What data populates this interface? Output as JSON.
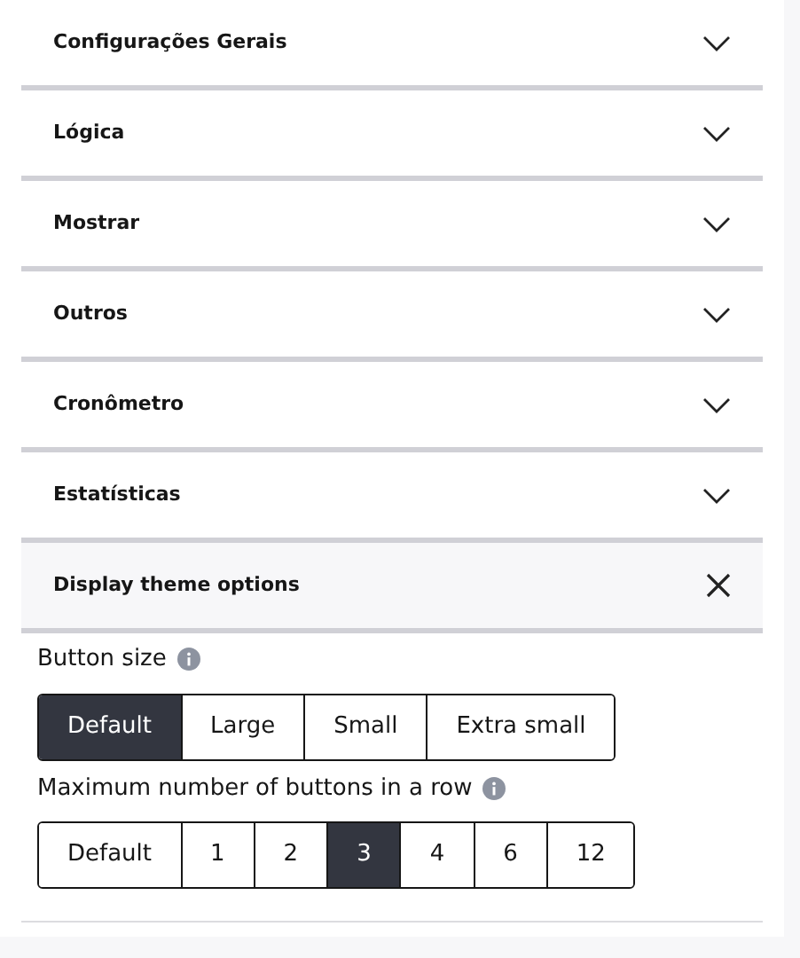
{
  "sections": [
    {
      "title": "Configurações Gerais",
      "expanded": false
    },
    {
      "title": "Lógica",
      "expanded": false
    },
    {
      "title": "Mostrar",
      "expanded": false
    },
    {
      "title": "Outros",
      "expanded": false
    },
    {
      "title": "Cronômetro",
      "expanded": false
    },
    {
      "title": "Estatísticas",
      "expanded": false
    },
    {
      "title": "Display theme options",
      "expanded": true,
      "fields": [
        {
          "label": "Button size",
          "options": [
            {
              "label": "Default",
              "selected": true
            },
            {
              "label": "Large",
              "selected": false
            },
            {
              "label": "Small",
              "selected": false
            },
            {
              "label": "Extra small",
              "selected": false
            }
          ]
        },
        {
          "label": "Maximum number of buttons in a row",
          "options": [
            {
              "label": "Default",
              "selected": false
            },
            {
              "label": "1",
              "selected": false
            },
            {
              "label": "2",
              "selected": false
            },
            {
              "label": "3",
              "selected": true
            },
            {
              "label": "4",
              "selected": false
            },
            {
              "label": "6",
              "selected": false
            },
            {
              "label": "12",
              "selected": false
            }
          ]
        }
      ]
    }
  ]
}
